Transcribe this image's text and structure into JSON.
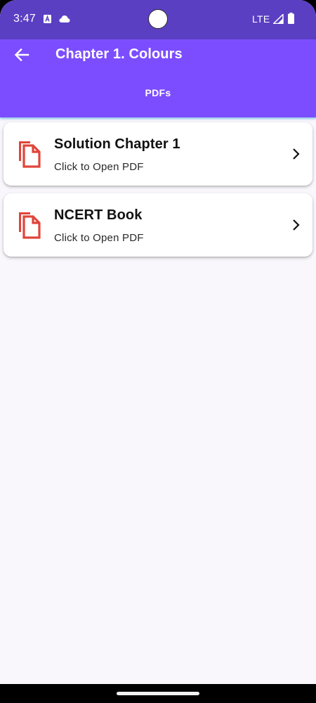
{
  "status_bar": {
    "time": "3:47",
    "network": "LTE",
    "icons": [
      "a-notification-icon",
      "cloud-icon",
      "camera-cutout",
      "signal-icon",
      "battery-icon"
    ]
  },
  "app_bar": {
    "title": "Chapter 1. Colours",
    "back_icon": "arrow-back-icon",
    "tab_label": "PDFs"
  },
  "pdf_list": {
    "items": [
      {
        "title": "Solution Chapter 1",
        "subtitle": "Click to Open PDF",
        "icon": "file-copy-icon",
        "trailing_icon": "chevron-right-icon"
      },
      {
        "title": "NCERT Book",
        "subtitle": "Click to Open PDF",
        "icon": "file-copy-icon",
        "trailing_icon": "chevron-right-icon"
      }
    ]
  },
  "colors": {
    "status_bar": "#5b3fc2",
    "app_bar": "#7c4dff",
    "pdf_icon": "#e0453a",
    "background": "#f9f7fb",
    "card": "#ffffff"
  }
}
